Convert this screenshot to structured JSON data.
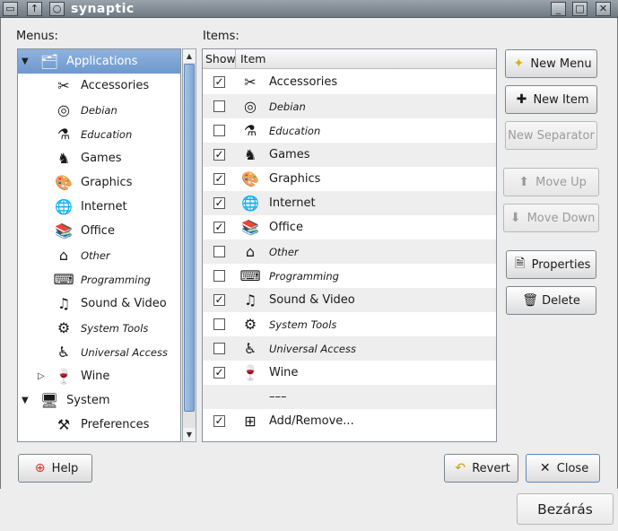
{
  "window": {
    "title": "synaptic",
    "controls": [
      "window-menu-icon",
      "up-arrow-icon",
      "circle-icon",
      "minimize-icon",
      "maximize-icon",
      "close-icon"
    ]
  },
  "menus_panel": {
    "label": "Menus:",
    "items": [
      {
        "label": "Applications",
        "icon": "applications-icon",
        "level": 0,
        "expander": "down",
        "selected": true,
        "italic": false
      },
      {
        "label": "Accessories",
        "icon": "accessories-icon",
        "level": 1,
        "italic": false
      },
      {
        "label": "Debian",
        "icon": "debian-icon",
        "level": 1,
        "italic": true
      },
      {
        "label": "Education",
        "icon": "education-icon",
        "level": 1,
        "italic": true
      },
      {
        "label": "Games",
        "icon": "games-icon",
        "level": 1,
        "italic": false
      },
      {
        "label": "Graphics",
        "icon": "graphics-icon",
        "level": 1,
        "italic": false
      },
      {
        "label": "Internet",
        "icon": "internet-icon",
        "level": 1,
        "italic": false
      },
      {
        "label": "Office",
        "icon": "office-icon",
        "level": 1,
        "italic": false
      },
      {
        "label": "Other",
        "icon": "other-icon",
        "level": 1,
        "italic": true
      },
      {
        "label": "Programming",
        "icon": "programming-icon",
        "level": 1,
        "italic": true
      },
      {
        "label": "Sound & Video",
        "icon": "sound-video-icon",
        "level": 1,
        "italic": false
      },
      {
        "label": "System Tools",
        "icon": "system-tools-icon",
        "level": 1,
        "italic": true
      },
      {
        "label": "Universal Access",
        "icon": "universal-access-icon",
        "level": 1,
        "italic": true
      },
      {
        "label": "Wine",
        "icon": "wine-icon",
        "level": 1,
        "expander": "right",
        "italic": false
      },
      {
        "label": "System",
        "icon": "system-icon",
        "level": 0,
        "expander": "down",
        "italic": false
      },
      {
        "label": "Preferences",
        "icon": "preferences-icon",
        "level": 1,
        "italic": false
      }
    ]
  },
  "items_panel": {
    "label": "Items:",
    "headers": {
      "show": "Show",
      "item": "Item"
    },
    "rows": [
      {
        "label": "Accessories",
        "icon": "accessories-icon",
        "checked": true,
        "italic": false
      },
      {
        "label": "Debian",
        "icon": "debian-icon",
        "checked": false,
        "italic": true
      },
      {
        "label": "Education",
        "icon": "education-icon",
        "checked": false,
        "italic": true
      },
      {
        "label": "Games",
        "icon": "games-icon",
        "checked": true,
        "italic": false
      },
      {
        "label": "Graphics",
        "icon": "graphics-icon",
        "checked": true,
        "italic": false
      },
      {
        "label": "Internet",
        "icon": "internet-icon",
        "checked": true,
        "italic": false
      },
      {
        "label": "Office",
        "icon": "office-icon",
        "checked": true,
        "italic": false
      },
      {
        "label": "Other",
        "icon": "other-icon",
        "checked": false,
        "italic": true
      },
      {
        "label": "Programming",
        "icon": "programming-icon",
        "checked": false,
        "italic": true
      },
      {
        "label": "Sound & Video",
        "icon": "sound-video-icon",
        "checked": true,
        "italic": false
      },
      {
        "label": "System Tools",
        "icon": "system-tools-icon",
        "checked": false,
        "italic": true
      },
      {
        "label": "Universal Access",
        "icon": "universal-access-icon",
        "checked": false,
        "italic": true
      },
      {
        "label": "Wine",
        "icon": "wine-icon",
        "checked": true,
        "italic": false
      },
      {
        "label": "–––",
        "icon": "",
        "checked": null,
        "italic": false
      },
      {
        "label": "Add/Remove...",
        "icon": "add-remove-icon",
        "checked": true,
        "italic": false
      }
    ]
  },
  "buttons": {
    "new_menu": "New Menu",
    "new_item": "New Item",
    "new_separator": "New Separator",
    "move_up": "Move Up",
    "move_down": "Move Down",
    "properties": "Properties",
    "delete": "Delete",
    "help": "Help",
    "revert": "Revert",
    "close": "Close",
    "bezaras": "Bezárás"
  },
  "colors": {
    "selection": "#7aa1d2",
    "window_bg": "#ededed",
    "titlebar": "#7f8890"
  }
}
